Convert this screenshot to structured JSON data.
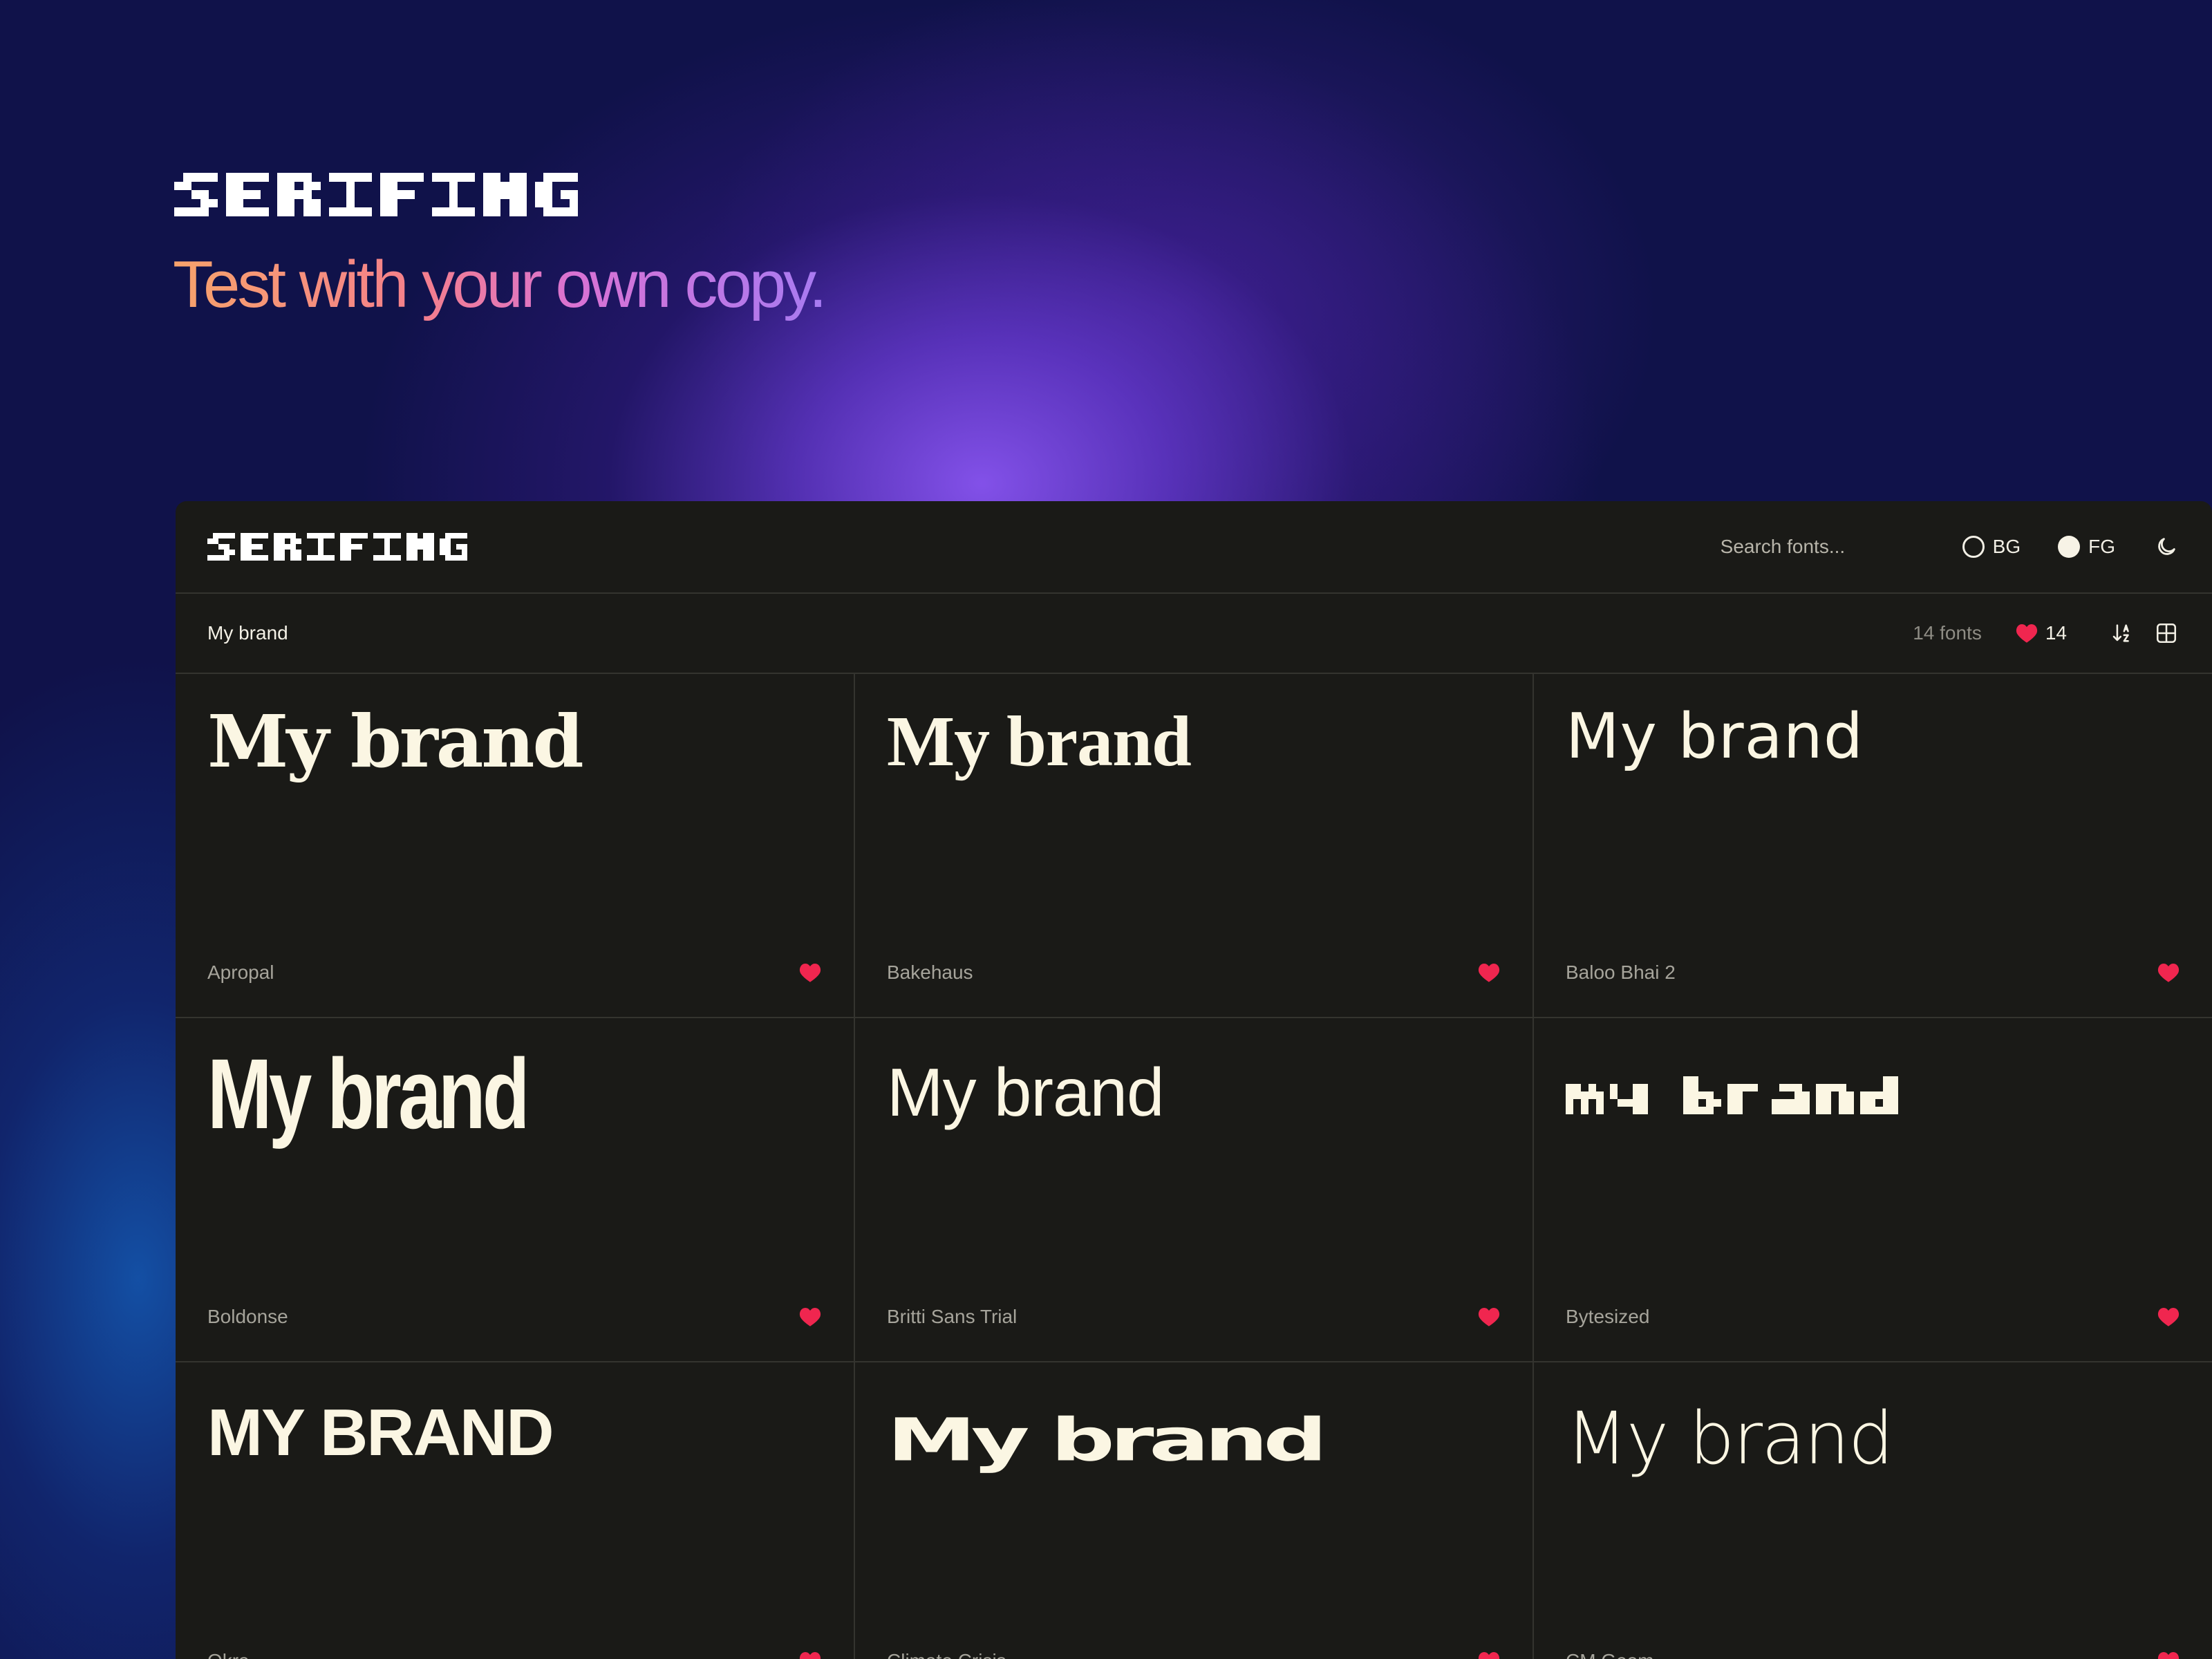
{
  "hero": {
    "logo_text": "SERIFING",
    "tagline": "Test with your own copy."
  },
  "topbar": {
    "logo_text": "SERIFING",
    "search_placeholder": "Search fonts...",
    "bg_label": "BG",
    "fg_label": "FG",
    "theme_icon": "moon-icon"
  },
  "subbar": {
    "sample_text": "My brand",
    "font_count": "14 fonts",
    "favorites_count": "14",
    "sort_icon": "sort-az-icon",
    "layout_icon": "grid-icon"
  },
  "colors": {
    "accent_heart": "#f0264f",
    "card_bg": "#1a1a17",
    "preview_text": "#fbf6e3"
  },
  "cards": [
    {
      "preview": "My brand",
      "font_name": "Apropal",
      "favorited": true
    },
    {
      "preview": "My brand",
      "font_name": "Bakehaus",
      "favorited": true
    },
    {
      "preview": "My brand",
      "font_name": "Baloo Bhai 2",
      "favorited": true
    },
    {
      "preview": "My brand",
      "font_name": "Boldonse",
      "favorited": true
    },
    {
      "preview": "My brand",
      "font_name": "Britti Sans Trial",
      "favorited": true
    },
    {
      "preview": "My brand",
      "font_name": "Bytesized",
      "favorited": true
    },
    {
      "preview": "MY BRAND",
      "font_name": "Okra",
      "favorited": true
    },
    {
      "preview": "My brand",
      "font_name": "Climate Crisis",
      "favorited": true
    },
    {
      "preview": "My brand",
      "font_name": "CM Geom",
      "favorited": true
    }
  ]
}
